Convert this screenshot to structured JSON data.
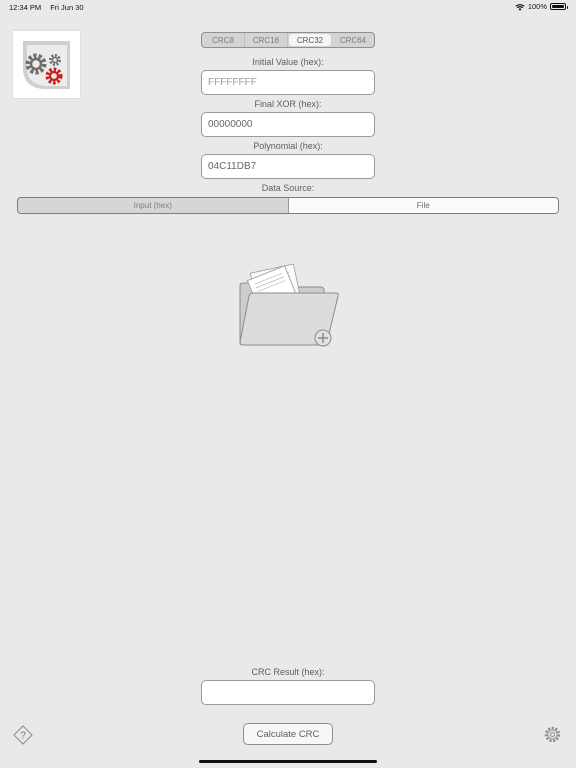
{
  "status_bar": {
    "time": "12:34 PM",
    "date": "Fri Jun 30",
    "battery": "100%"
  },
  "crc_types": {
    "options": [
      "CRC8",
      "CRC16",
      "CRC32",
      "CRC64"
    ],
    "selected": "CRC32"
  },
  "initial_value": {
    "label": "Initial Value (hex):",
    "placeholder": "FFFFFFFF"
  },
  "final_xor": {
    "label": "Final XOR (hex):",
    "value": "00000000"
  },
  "polynomial": {
    "label": "Polynomial (hex):",
    "value": "04C11DB7"
  },
  "data_source": {
    "label": "Data Source:",
    "options": [
      "Input (hex)",
      "File"
    ],
    "selected": "File"
  },
  "result": {
    "label": "CRC Result (hex):",
    "value": ""
  },
  "actions": {
    "calculate_label": "Calculate CRC"
  },
  "icons": {
    "logo": "gears-logo-icon",
    "file_picker": "folder-add-icon",
    "help": "help-icon",
    "settings": "gear-icon"
  },
  "colors": {
    "background": "#e9e9e9",
    "logo_red_gear": "#c62020",
    "logo_gray_gear": "#777777"
  }
}
